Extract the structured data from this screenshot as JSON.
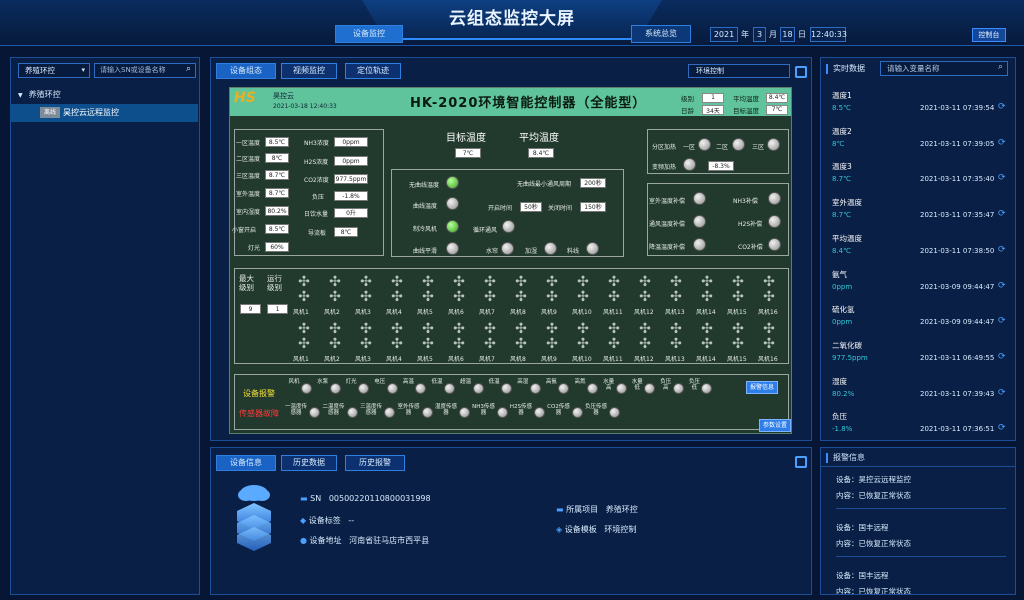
{
  "header": {
    "title": "云组态监控大屏",
    "tab_device_monitor": "设备监控",
    "tab_system_overview": "系统总览",
    "year": "2021",
    "year_unit": "年",
    "month": "3",
    "month_unit": "月",
    "day": "18",
    "day_unit": "日",
    "time": "12:40:33",
    "control_button": "控制台"
  },
  "left": {
    "group_select": "养殖环控",
    "search_placeholder": "请输入SN或设备名称",
    "tree_root": "养殖环控",
    "tree_child_badge": "离线",
    "tree_child_label": "昊控云远程监控"
  },
  "center": {
    "tabs": [
      "设备组态",
      "视频监控",
      "定位轨迹"
    ],
    "select": "环境控制"
  },
  "hmi": {
    "brand": "昊控云",
    "logo": "HS",
    "datetime": "2021-03-18 12:40:33",
    "title": "HK-2020环境智能控制器（全能型）",
    "level_label": "级别",
    "level_value": "1",
    "avg_temp_label": "平均温度",
    "avg_temp_value": "8.4℃",
    "day_age_label": "日龄",
    "day_age_value": "34天",
    "target_temp_label": "目标温度",
    "target_temp_value": "7℃",
    "sensors_left": [
      {
        "label": "一区温度",
        "value": "8.5℃"
      },
      {
        "label": "二区温度",
        "value": "8℃"
      },
      {
        "label": "三区温度",
        "value": "8.7℃"
      },
      {
        "label": "室外温度",
        "value": "8.7℃"
      },
      {
        "label": "室内湿度",
        "value": "80.2%"
      },
      {
        "label": "小窗开启",
        "value": "8.5℃"
      },
      {
        "label": "灯光",
        "value": "60%"
      }
    ],
    "sensors_right": [
      {
        "label": "NH3浓度",
        "value": "0ppm"
      },
      {
        "label": "H2S浓度",
        "value": "0ppm"
      },
      {
        "label": "CO2浓度",
        "value": "977.5ppm"
      },
      {
        "label": "负压",
        "value": "-1.8%"
      },
      {
        "label": "日饮水量",
        "value": "0升"
      },
      {
        "label": "导流板",
        "value": "8℃"
      }
    ],
    "target_temp_big": "目标温度",
    "target_temp_big_value": "7℃",
    "avg_temp_big": "平均温度",
    "avg_temp_big_value": "8.4℃",
    "mode": {
      "no_curve_temp": "无曲线温度",
      "curve_temp": "曲线温度",
      "cool_fan": "制冷风机",
      "curve_flat": "曲线平滑",
      "min_vent_cycle": "无曲线最小通风周期",
      "min_vent_cycle_value": "200秒",
      "open_time": "开启时间",
      "open_time_value": "50秒",
      "close_time": "关闭时间",
      "close_time_value": "150秒",
      "circ_vent": "循环通风",
      "water_curtain": "水帘",
      "humidify": "加湿",
      "feed_line": "料线"
    },
    "heating": {
      "zone_heat": "分区加热",
      "zone1": "一区",
      "zone2": "二区",
      "zone3": "三区",
      "var_heat": "变频加热",
      "var_heat_value": "-8.3%"
    },
    "compensation": [
      {
        "label": "室外温度补偿"
      },
      {
        "label": "NH3补偿"
      },
      {
        "label": "通风温度补偿"
      },
      {
        "label": "H2S补偿"
      },
      {
        "label": "降温温度补偿"
      },
      {
        "label": "CO2补偿"
      }
    ],
    "fans": {
      "max_level_label": "最大级别",
      "max_level_value": "9",
      "run_level_label": "运行级别",
      "run_level_value": "1",
      "names": [
        "风机1",
        "风机2",
        "风机3",
        "风机4",
        "风机5",
        "风机6",
        "风机7",
        "风机8",
        "风机9",
        "风机10",
        "风机11",
        "风机12",
        "风机13",
        "风机14",
        "风机15",
        "风机16"
      ]
    },
    "alarm": {
      "device_alarm": "设备报警",
      "sensor_fault": "传感器故障",
      "device_items": [
        "风机",
        "水泵",
        "灯光",
        "电压",
        "高温",
        "低温",
        "超温",
        "低温",
        "高湿",
        "高氨",
        "高氮",
        "水量高",
        "水量低",
        "负压高",
        "负压低"
      ],
      "sensor_items": [
        "一温度传感器",
        "二温度传感器",
        "三温度传感器",
        "室外传感器",
        "湿度传感器",
        "NH3传感器",
        "H2S传感器",
        "CO2传感器",
        "负压传感器"
      ],
      "alarm_info_btn": "报警信息",
      "param_btn": "参数设置"
    }
  },
  "info": {
    "tabs": [
      "设备信息",
      "历史数据",
      "历史报警"
    ],
    "sn_label": "SN",
    "sn_value": "0050022011080003​1998",
    "tag_label": "设备标签",
    "tag_value": "--",
    "addr_label": "设备地址",
    "addr_value": "河南省驻马店市西平县",
    "project_label": "所属项目",
    "project_value": "养殖环控",
    "template_label": "设备模板",
    "template_value": "环境控制"
  },
  "realtime": {
    "title": "实时数据",
    "search_placeholder": "请输入变量名称",
    "items": [
      {
        "name": "温度1",
        "value": "8.5℃",
        "time": "2021-03-11 07:39:54"
      },
      {
        "name": "温度2",
        "value": "8℃",
        "time": "2021-03-11 07:39:05"
      },
      {
        "name": "温度3",
        "value": "8.7℃",
        "time": "2021-03-11 07:35:40"
      },
      {
        "name": "室外温度",
        "value": "8.7℃",
        "time": "2021-03-11 07:35:47"
      },
      {
        "name": "平均温度",
        "value": "8.4℃",
        "time": "2021-03-11 07:38:50"
      },
      {
        "name": "氨气",
        "value": "0ppm",
        "time": "2021-03-09 09:44:47"
      },
      {
        "name": "硫化氢",
        "value": "0ppm",
        "time": "2021-03-09 09:44:47"
      },
      {
        "name": "二氧化碳",
        "value": "977.5ppm",
        "time": "2021-03-11 06:49:55"
      },
      {
        "name": "湿度",
        "value": "80.2%",
        "time": "2021-03-11 07:39:43"
      },
      {
        "name": "负压",
        "value": "-1.8%",
        "time": "2021-03-11 07:36:51"
      }
    ]
  },
  "alarms": {
    "title": "报警信息",
    "items": [
      {
        "device": "设备：昊控云远程监控",
        "content": "内容：已恢复正常状态"
      },
      {
        "device": "设备：国丰远程",
        "content": "内容：已恢复正常状态"
      },
      {
        "device": "设备：国丰远程",
        "content": "内容：已恢复正常状态"
      }
    ]
  }
}
